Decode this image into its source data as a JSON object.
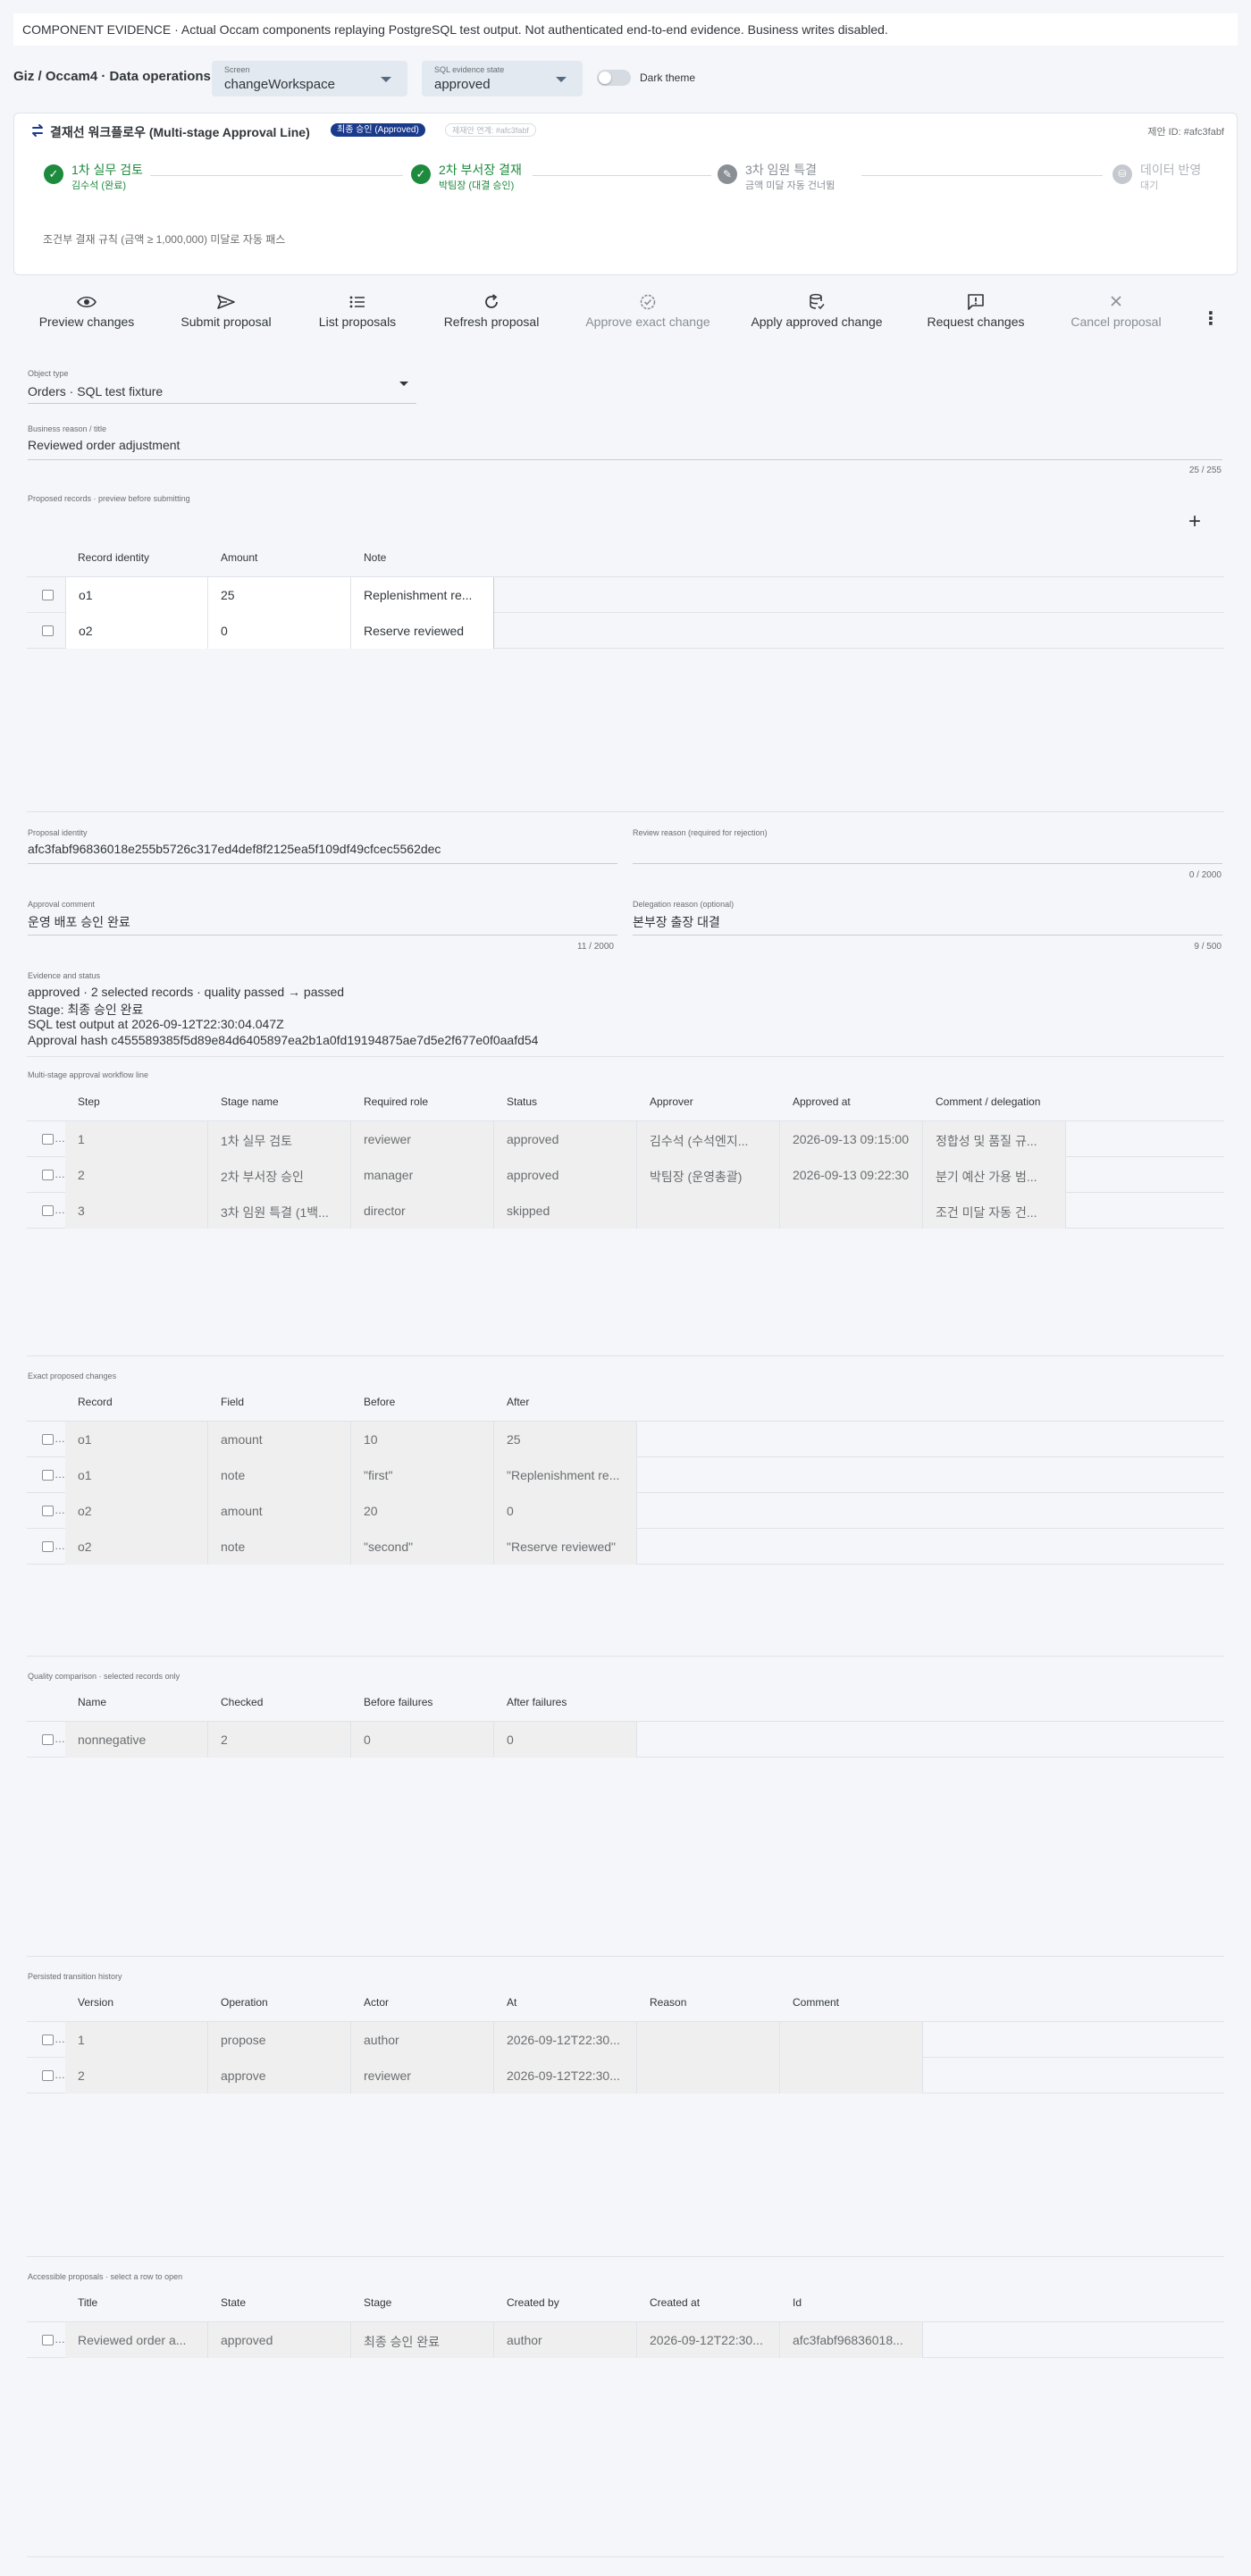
{
  "banner": {
    "text": "COMPONENT EVIDENCE · Actual Occam components replaying PostgreSQL test output. Not authenticated end-to-end evidence. Business writes disabled."
  },
  "header": {
    "title": "Giz / Occam4 · Data operations",
    "screen_select": {
      "label": "Screen",
      "value": "changeWorkspace"
    },
    "evidence_select": {
      "label": "SQL evidence state",
      "value": "approved"
    },
    "dark_theme_label": "Dark theme"
  },
  "workflow": {
    "title": "결재선 워크플로우 (Multi-stage Approval Line)",
    "badge_final": "최종 승인 (Approved)",
    "badge_link": "제재안 연계: #afc3fabf",
    "proposal_id": "제안 ID: #afc3fabf",
    "steps": [
      {
        "name": "1차 실무 검토",
        "sub": "김수석 (완료)",
        "state": "done"
      },
      {
        "name": "2차 부서장 결재",
        "sub": "박팀장 (대결 승인)",
        "state": "done"
      },
      {
        "name": "3차 임원 특결",
        "sub": "금액 미달 자동 건너뜀",
        "state": "skipped"
      },
      {
        "name": "데이터 반영",
        "sub": "대기",
        "state": "pending"
      }
    ],
    "note": "조건부 결재 규칙 (금액 ≥ 1,000,000) 미달로 자동 패스"
  },
  "toolbar": {
    "preview": "Preview changes",
    "submit": "Submit proposal",
    "list": "List proposals",
    "refresh": "Refresh proposal",
    "approve": "Approve exact change",
    "apply": "Apply approved change",
    "request": "Request changes",
    "cancel": "Cancel proposal"
  },
  "form": {
    "object_type": {
      "label": "Object type",
      "value": "Orders · SQL test fixture"
    },
    "business_reason": {
      "label": "Business reason / title",
      "value": "Reviewed order adjustment",
      "counter": "25 / 255"
    },
    "proposal_identity": {
      "label": "Proposal identity",
      "value": "afc3fabf96836018e255b5726c317ed4def8f2125ea5f109df49cfcec5562dec"
    },
    "review_reason": {
      "label": "Review reason (required for rejection)",
      "value": "",
      "counter": "0 / 2000"
    },
    "approval_comment": {
      "label": "Approval comment",
      "value": "운영 배포 승인 완료",
      "counter": "11 / 2000"
    },
    "delegation_reason": {
      "label": "Delegation reason (optional)",
      "value": "본부장 출장 대결",
      "counter": "9 / 500"
    }
  },
  "proposed_records": {
    "label": "Proposed records · preview before submitting",
    "headers": [
      "Record identity",
      "Amount",
      "Note"
    ],
    "rows": [
      [
        "o1",
        "25",
        "Replenishment re..."
      ],
      [
        "o2",
        "0",
        "Reserve reviewed"
      ]
    ]
  },
  "evidence": {
    "label": "Evidence and status",
    "lines": [
      "approved · 2 selected records · quality passed → passed",
      "Stage: 최종 승인 완료",
      "SQL test output at 2026-09-12T22:30:04.047Z",
      "Approval hash c455589385f5d89e84d6405897ea2b1a0fd19194875ae7d5e2f677e0f0aafd54"
    ]
  },
  "workflow_table": {
    "label": "Multi-stage approval workflow line",
    "headers": [
      "Step",
      "Stage name",
      "Required role",
      "Status",
      "Approver",
      "Approved at",
      "Comment / delegation"
    ],
    "rows": [
      [
        "1",
        "1차 실무 검토",
        "reviewer",
        "approved",
        "김수석 (수석엔지...",
        "2026-09-13 09:15:00",
        "정합성 및 품질 규..."
      ],
      [
        "2",
        "2차 부서장 승인",
        "manager",
        "approved",
        "박팀장 (운영총괄)",
        "2026-09-13 09:22:30",
        "분기 예산 가용 범..."
      ],
      [
        "3",
        "3차 임원 특결 (1백...",
        "director",
        "skipped",
        "",
        "",
        "조건 미달 자동 건..."
      ]
    ]
  },
  "changes_table": {
    "label": "Exact proposed changes",
    "headers": [
      "Record",
      "Field",
      "Before",
      "After"
    ],
    "rows": [
      [
        "o1",
        "amount",
        "10",
        "25"
      ],
      [
        "o1",
        "note",
        "\"first\"",
        "\"Replenishment re..."
      ],
      [
        "o2",
        "amount",
        "20",
        "0"
      ],
      [
        "o2",
        "note",
        "\"second\"",
        "\"Reserve reviewed\""
      ]
    ]
  },
  "quality_table": {
    "label": "Quality comparison · selected records only",
    "headers": [
      "Name",
      "Checked",
      "Before failures",
      "After failures"
    ],
    "rows": [
      [
        "nonnegative",
        "2",
        "0",
        "0"
      ]
    ]
  },
  "history_table": {
    "label": "Persisted transition history",
    "headers": [
      "Version",
      "Operation",
      "Actor",
      "At",
      "Reason",
      "Comment"
    ],
    "rows": [
      [
        "1",
        "propose",
        "author",
        "2026-09-12T22:30...",
        "",
        ""
      ],
      [
        "2",
        "approve",
        "reviewer",
        "2026-09-12T22:30...",
        "",
        ""
      ]
    ]
  },
  "proposals_table": {
    "label": "Accessible proposals · select a row to open",
    "headers": [
      "Title",
      "State",
      "Stage",
      "Created by",
      "Created at",
      "Id"
    ],
    "rows": [
      [
        "Reviewed order a...",
        "approved",
        "최종 승인 완료",
        "author",
        "2026-09-12T22:30...",
        "afc3fabf96836018..."
      ]
    ]
  },
  "colors": {
    "accent": "#1a3a8c",
    "success": "#1e8a3e",
    "muted": "#8a8f96"
  }
}
